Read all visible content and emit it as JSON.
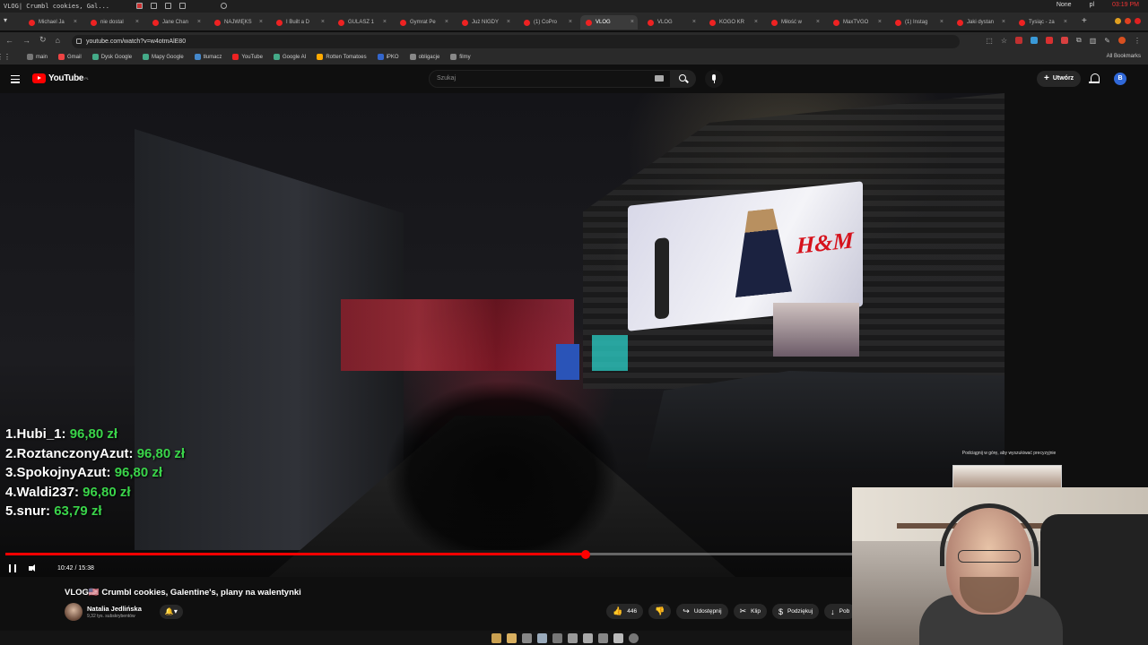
{
  "window": {
    "title": "VLOG| Crumbl cookies, Gal...",
    "status_none": "None",
    "lang": "pl",
    "clock": "03:19 PM"
  },
  "tabs": [
    {
      "label": "Michael Ja"
    },
    {
      "label": "nie dostal"
    },
    {
      "label": "Jane Chan"
    },
    {
      "label": "NAJWIĘKS"
    },
    {
      "label": "I Built a D"
    },
    {
      "label": "GULASZ 1"
    },
    {
      "label": "Gymrat Pe"
    },
    {
      "label": "Już NIGDY"
    },
    {
      "label": "(1) CoPro"
    },
    {
      "label": "VLOG",
      "active": true
    },
    {
      "label": "VLOG"
    },
    {
      "label": "KOGO KR"
    },
    {
      "label": "Miłość w"
    },
    {
      "label": "MaxTVGO"
    },
    {
      "label": "(1) Instag"
    },
    {
      "label": "Jaki dystan"
    },
    {
      "label": "Tysiąc - za"
    }
  ],
  "address": {
    "url": "youtube.com/watch?v=w4otmAlE80"
  },
  "bookmarks": {
    "items": [
      {
        "label": "main"
      },
      {
        "label": "Gmail"
      },
      {
        "label": "Dysk Google"
      },
      {
        "label": "Mapy Google"
      },
      {
        "label": "tłumacz"
      },
      {
        "label": "YouTube"
      },
      {
        "label": "Google AI"
      },
      {
        "label": "Rotten Tomatoes"
      },
      {
        "label": "iPKO"
      },
      {
        "label": "obligacje"
      },
      {
        "label": "filmy"
      }
    ],
    "all_label": "All Bookmarks"
  },
  "youtube": {
    "logo_text": "YouTube",
    "logo_region": "PL",
    "search_placeholder": "Szukaj",
    "create_label": "Utwórz",
    "avatar_letter": "B"
  },
  "overlay": {
    "ranking": [
      {
        "rank": "1.",
        "name": "Hubi_1:",
        "amount": "96,80 zł"
      },
      {
        "rank": "2.",
        "name": "RoztanczonyAzut:",
        "amount": "96,80 zł"
      },
      {
        "rank": "3.",
        "name": "SpokojnyAzut:",
        "amount": "96,80 zł"
      },
      {
        "rank": "4.",
        "name": "Waldi237:",
        "amount": "96,80 zł"
      },
      {
        "rank": "5.",
        "name": "snur:",
        "amount": "63,79 zł"
      }
    ],
    "hint": "Podciągnij w górę, aby wyszukiwać precyzyjnie"
  },
  "player": {
    "current_time": "10:42",
    "duration": "15:38",
    "time_text": "10:42 / 15:38",
    "progress": 0.685
  },
  "video": {
    "title": "VLOG🇺🇸 Crumbl cookies, Galentine's, plany na walentynki",
    "channel": "Natalia Jedlińska",
    "subscribers": "9,32 tys. subskrybentów"
  },
  "actions": {
    "likes": "446",
    "share": "Udostępnij",
    "clip": "Klip",
    "thanks": "Podziękuj",
    "download": "Pob"
  },
  "colors": {
    "accent": "#ff0000",
    "amount": "#3ad44a",
    "background": "#0f0f0f"
  }
}
